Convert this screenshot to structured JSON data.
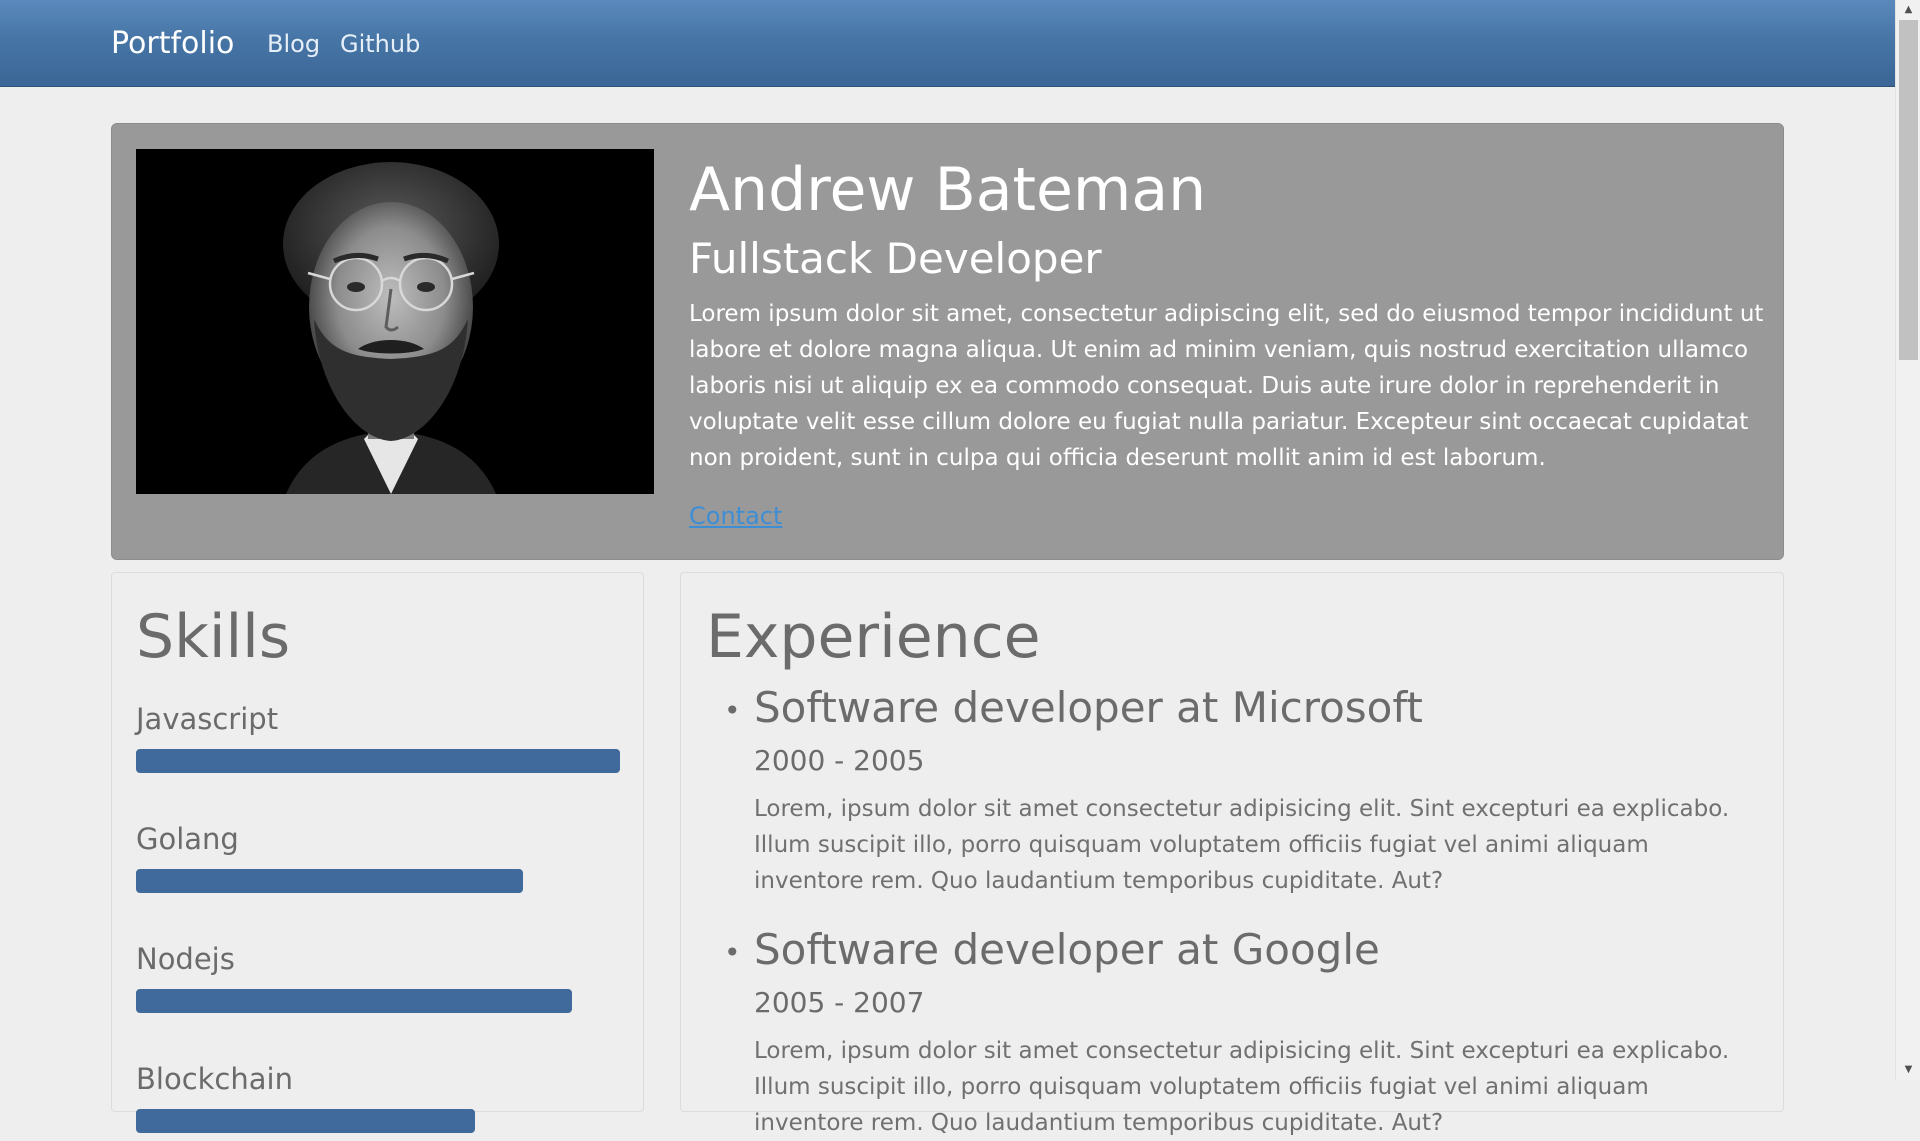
{
  "navbar": {
    "brand": "Portfolio",
    "links": [
      "Blog",
      "Github"
    ]
  },
  "hero": {
    "photo_icon": "portrait-photo",
    "name": "Andrew Bateman",
    "title": "Fullstack Developer",
    "bio": "Lorem ipsum dolor sit amet, consectetur adipiscing elit, sed do eiusmod tempor incididunt ut labore et dolore magna aliqua. Ut enim ad minim veniam, quis nostrud exercitation ullamco laboris nisi ut aliquip ex ea commodo consequat. Duis aute irure dolor in reprehenderit in voluptate velit esse cillum dolore eu fugiat nulla pariatur. Excepteur sint occaecat cupidatat non proident, sunt in culpa qui officia deserunt mollit anim id est laborum.",
    "contact_label": "Contact"
  },
  "skills": {
    "heading": "Skills",
    "items": [
      {
        "label": "Javascript",
        "level": 1.0
      },
      {
        "label": "Golang",
        "level": 0.8
      },
      {
        "label": "Nodejs",
        "level": 0.9
      },
      {
        "label": "Blockchain",
        "level": 0.7
      }
    ]
  },
  "experience": {
    "heading": "Experience",
    "items": [
      {
        "title": "Software developer at Microsoft",
        "years": "2000 - 2005",
        "description": "Lorem, ipsum dolor sit amet consectetur adipisicing elit. Sint excepturi ea explicabo. Illum suscipit illo, porro quisquam voluptatem officiis fugiat vel animi aliquam inventore rem. Quo laudantium temporibus cupiditate. Aut?"
      },
      {
        "title": "Software developer at Google",
        "years": "2005 - 2007",
        "description": "Lorem, ipsum dolor sit amet consectetur adipisicing elit. Sint excepturi ea explicabo. Illum suscipit illo, porro quisquam voluptatem officiis fugiat vel animi aliquam inventore rem. Quo laudantium temporibus cupiditate. Aut?"
      }
    ]
  },
  "colors": {
    "navbar": "#4675a6",
    "accent": "#3f6a9b",
    "hero_background": "#999999",
    "page_background": "#eeeeee",
    "link": "#3e8ed6"
  }
}
